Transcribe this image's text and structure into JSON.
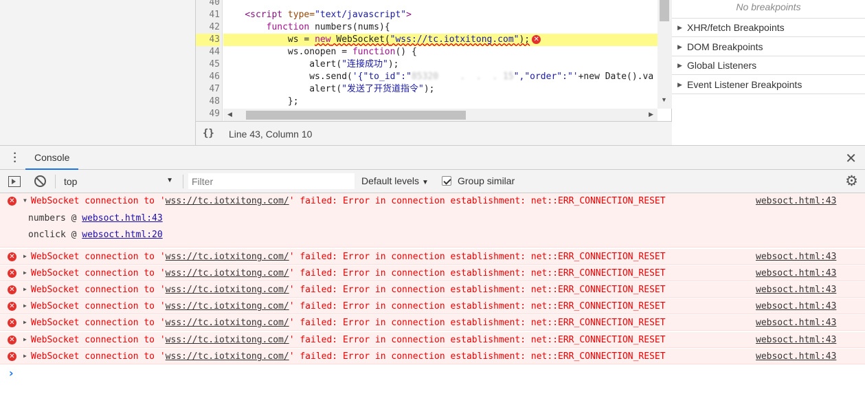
{
  "editor": {
    "line_numbers": [
      "40",
      "41",
      "42",
      "43",
      "44",
      "45",
      "46",
      "47",
      "48",
      "49"
    ],
    "lines": {
      "l41_tag_open": "<script",
      "l41_attr": " type=",
      "l41_val": "\"text/javascript\"",
      "l41_tag_close": ">",
      "l42_kw": "function",
      "l42_rest": " numbers(nums){",
      "l43_a": "ws = ",
      "l43_new": "new",
      "l43_b": " WebSocket(",
      "l43_str": "\"wss://tc.iotxitong.com\"",
      "l43_c": ");",
      "l44_a": "ws.onopen = ",
      "l44_kw": "function",
      "l44_b": "() {",
      "l45_a": "alert(",
      "l45_str": "\"连接成功\"",
      "l45_b": ");",
      "l46_a": "ws.send(",
      "l46_str1": "'{\"to_id\":\"",
      "l46_blur": "85320    .  .  . 15",
      "l46_str2": "\",\"order\":\"'",
      "l46_b": "+new Date().va",
      "l47_a": "alert(",
      "l47_str": "\"发送了开货道指令\"",
      "l47_b": ");",
      "l48": "};"
    },
    "status": {
      "format_icon": "{}",
      "cursor_position": "Line 43, Column 10"
    }
  },
  "breakpoints": {
    "empty_text": "No breakpoints",
    "sections": [
      {
        "label": "XHR/fetch Breakpoints"
      },
      {
        "label": "DOM Breakpoints"
      },
      {
        "label": "Global Listeners"
      },
      {
        "label": "Event Listener Breakpoints"
      }
    ]
  },
  "drawer": {
    "tab_label": "Console"
  },
  "toolbar": {
    "context": "top",
    "filter_placeholder": "Filter",
    "levels": "Default levels",
    "group_similar": "Group similar",
    "group_similar_checked": true
  },
  "console": {
    "expanded": {
      "prefix": "WebSocket connection to '",
      "url": "wss://tc.iotxitong.com/",
      "suffix": "' failed: Error in connection establishment: net::ERR_CONNECTION_RESET",
      "source": "websoct.html:43",
      "stack": [
        {
          "fn": "numbers @ ",
          "link": "websoct.html:43"
        },
        {
          "fn": "onclick @ ",
          "link": "websoct.html:20"
        }
      ]
    },
    "collapsed": [
      {
        "prefix": "WebSocket connection to '",
        "url": "wss://tc.iotxitong.com/",
        "suffix": "' failed: Error in connection establishment: net::ERR_CONNECTION_RESET",
        "source": "websoct.html:43"
      },
      {
        "prefix": "WebSocket connection to '",
        "url": "wss://tc.iotxitong.com/",
        "suffix": "' failed: Error in connection establishment: net::ERR_CONNECTION_RESET",
        "source": "websoct.html:43"
      },
      {
        "prefix": "WebSocket connection to '",
        "url": "wss://tc.iotxitong.com/",
        "suffix": "' failed: Error in connection establishment: net::ERR_CONNECTION_RESET",
        "source": "websoct.html:43"
      },
      {
        "prefix": "WebSocket connection to '",
        "url": "wss://tc.iotxitong.com/",
        "suffix": "' failed: Error in connection establishment: net::ERR_CONNECTION_RESET",
        "source": "websoct.html:43"
      },
      {
        "prefix": "WebSocket connection to '",
        "url": "wss://tc.iotxitong.com/",
        "suffix": "' failed: Error in connection establishment: net::ERR_CONNECTION_RESET",
        "source": "websoct.html:43"
      },
      {
        "prefix": "WebSocket connection to '",
        "url": "wss://tc.iotxitong.com/",
        "suffix": "' failed: Error in connection establishment: net::ERR_CONNECTION_RESET",
        "source": "websoct.html:43"
      },
      {
        "prefix": "WebSocket connection to '",
        "url": "wss://tc.iotxitong.com/",
        "suffix": "' failed: Error in connection establishment: net::ERR_CONNECTION_RESET",
        "source": "websoct.html:43"
      }
    ],
    "prompt": "›"
  },
  "colors": {
    "error_text": "#e00000",
    "error_bg": "#fff0f0",
    "highlight_line": "#fffb8a",
    "tab_accent": "#1a73e8"
  },
  "icons": {
    "error": "x-circle-icon",
    "settings": "gear-icon",
    "close": "close-icon",
    "clear": "block-icon",
    "sidebar": "sidebar-toggle-icon"
  }
}
